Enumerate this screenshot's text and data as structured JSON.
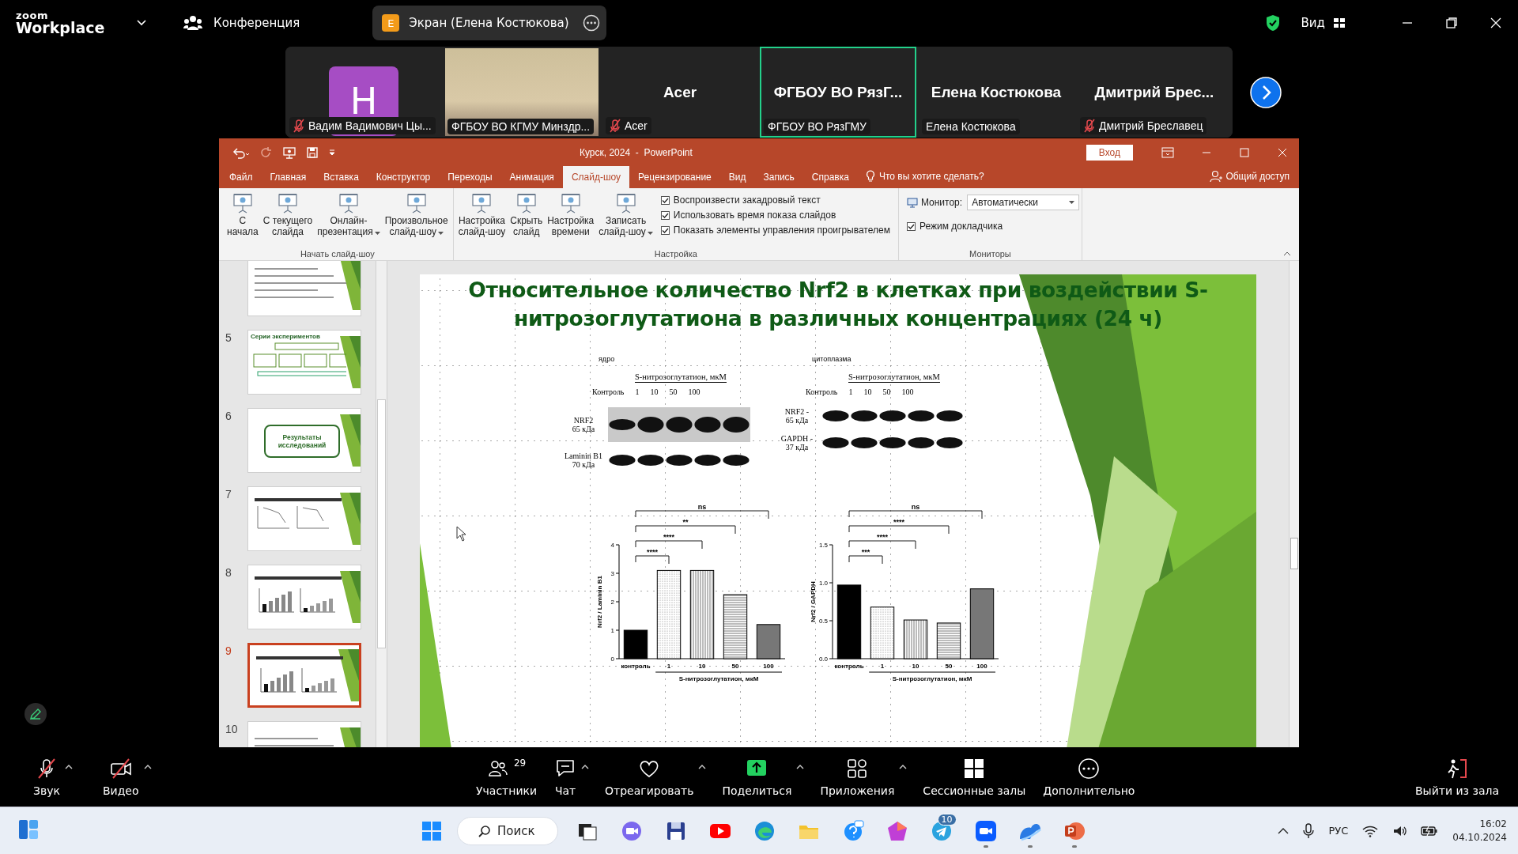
{
  "zoom_bar": {
    "logo_top": "zoom",
    "logo_bottom": "Workplace",
    "meeting": "Конференция",
    "share_pill": {
      "badge": "E",
      "label": "Экран (Елена Костюкова)"
    },
    "view": "Вид"
  },
  "participants": [
    {
      "kind": "avatar",
      "initial": "H",
      "name": "Вадим Вадимович Цы...",
      "muted": true,
      "speaking": false
    },
    {
      "kind": "video",
      "name": "ФГБОУ ВО КГМУ Минздр...",
      "muted": false,
      "speaking": false
    },
    {
      "kind": "text",
      "display": "Acer",
      "name": "Acer",
      "muted": true,
      "speaking": false
    },
    {
      "kind": "text",
      "display": "ФГБОУ ВО РязГ...",
      "name": "ФГБОУ ВО РязГМУ",
      "muted": false,
      "speaking": true
    },
    {
      "kind": "text",
      "display": "Елена Костюкова",
      "name": "Елена Костюкова",
      "muted": false,
      "speaking": false
    },
    {
      "kind": "text",
      "display": "Дмитрий Брес...",
      "name": "Дмитрий Бреславец",
      "muted": true,
      "speaking": false
    }
  ],
  "powerpoint": {
    "title": "Курск, 2024  -  PowerPoint",
    "sign_in": "Вход",
    "tabs": [
      {
        "label": "Файл",
        "selected": false
      },
      {
        "label": "Главная",
        "selected": false
      },
      {
        "label": "Вставка",
        "selected": false
      },
      {
        "label": "Конструктор",
        "selected": false
      },
      {
        "label": "Переходы",
        "selected": false
      },
      {
        "label": "Анимация",
        "selected": false
      },
      {
        "label": "Слайд-шоу",
        "selected": true
      },
      {
        "label": "Рецензирование",
        "selected": false
      },
      {
        "label": "Вид",
        "selected": false
      },
      {
        "label": "Запись",
        "selected": false
      },
      {
        "label": "Справка",
        "selected": false
      }
    ],
    "tell_me": "Что вы хотите сделать?",
    "share": "Общий доступ",
    "groups": [
      {
        "label": "Начать слайд-шоу",
        "buttons": [
          {
            "lines": [
              "С",
              "начала"
            ],
            "dropdown": false
          },
          {
            "lines": [
              "С текущего",
              "слайда"
            ],
            "dropdown": false
          },
          {
            "lines": [
              "Онлайн-",
              "презентация"
            ],
            "dropdown": true
          },
          {
            "lines": [
              "Произвольное",
              "слайд-шоу"
            ],
            "dropdown": true
          }
        ]
      },
      {
        "label": "Настройка",
        "buttons": [
          {
            "lines": [
              "Настройка",
              "слайд-шоу"
            ],
            "dropdown": false
          },
          {
            "lines": [
              "Скрыть",
              "слайд"
            ],
            "dropdown": false
          },
          {
            "lines": [
              "Настройка",
              "времени"
            ],
            "dropdown": false
          },
          {
            "lines": [
              "Записать",
              "слайд-шоу"
            ],
            "dropdown": true
          }
        ],
        "checkboxes": [
          {
            "label": "Воспроизвести закадровый текст",
            "checked": true
          },
          {
            "label": "Использовать время показа слайдов",
            "checked": true
          },
          {
            "label": "Показать элементы управления проигрывателем",
            "checked": true
          }
        ]
      },
      {
        "label": "Мониторы",
        "monitor": {
          "label": "Монитор:",
          "value": "Автоматически"
        },
        "checkboxes": [
          {
            "label": "Режим докладчика",
            "checked": true
          }
        ]
      }
    ],
    "thumbnails": [
      {
        "kind": "bullets",
        "selected": false
      },
      {
        "number": "5",
        "kind": "diagram",
        "title": "Серии экспериментов",
        "selected": false
      },
      {
        "number": "6",
        "kind": "section",
        "title": "Результаты исследований",
        "selected": false
      },
      {
        "number": "7",
        "kind": "lines",
        "selected": false
      },
      {
        "number": "8",
        "kind": "bars",
        "selected": false
      },
      {
        "number": "9",
        "kind": "bars",
        "selected": true
      },
      {
        "number": "10",
        "kind": "bullets",
        "selected": false
      }
    ],
    "slide": {
      "title": "Относительное количество Nrf2 в клетках при воздействии S-нитрозоглутатиона в различных концентрациях (24 ч)",
      "blots": [
        {
          "compartment": "ядро",
          "treatment": "S-нитрозоглутатион, мкМ",
          "lanes": [
            "Контроль",
            "1",
            "10",
            "50",
            "100"
          ],
          "rows": [
            {
              "protein": "NRF2",
              "mass": "65 кДа"
            },
            {
              "protein": "Laminin B1",
              "mass": "70 кДа"
            }
          ]
        },
        {
          "compartment": "цитоплазма",
          "treatment": "S-нитрозоглутатион, мкМ",
          "lanes": [
            "Контроль",
            "1",
            "10",
            "50",
            "100"
          ],
          "rows": [
            {
              "protein": "NRF2 -",
              "mass": "65 кДа"
            },
            {
              "protein": "GAPDH -",
              "mass": "37 кДа"
            }
          ]
        }
      ],
      "charts": [
        {
          "chart_data": {
            "type": "bar",
            "xlabel": "S-нитрозоглутатион, мкМ",
            "ylabel": "Nrf2 / Laminin B1",
            "categories": [
              "контроль",
              "1",
              "10",
              "50",
              "100"
            ],
            "values": [
              1.0,
              3.1,
              3.1,
              2.25,
              1.2
            ],
            "ylim": [
              0,
              4
            ],
            "yticks": [
              0,
              1,
              2,
              3,
              4
            ],
            "annotations": [
              {
                "text": "****"
              },
              {
                "text": "****"
              },
              {
                "text": "**"
              },
              {
                "text": "ns"
              }
            ]
          }
        },
        {
          "chart_data": {
            "type": "bar",
            "xlabel": "S-нитрозоглутатион, мкМ",
            "ylabel": "Nrf2 / GAPDH",
            "categories": [
              "контроль",
              "1",
              "10",
              "50",
              "100"
            ],
            "values": [
              0.97,
              0.68,
              0.51,
              0.47,
              0.92
            ],
            "ylim": [
              0,
              1.5
            ],
            "yticks": [
              {
                "value": 0,
                "label": "0.0"
              },
              {
                "value": 0.5,
                "label": "0.5"
              },
              {
                "value": 1,
                "label": "1.0"
              },
              {
                "value": 1.5,
                "label": "1.5"
              }
            ],
            "annotations": [
              {
                "text": "***"
              },
              {
                "text": "****"
              },
              {
                "text": "****"
              },
              {
                "text": "ns"
              }
            ]
          }
        }
      ]
    }
  },
  "toolbar": [
    {
      "kind": "audio",
      "label": "Звук",
      "off": true,
      "caret": true
    },
    {
      "kind": "video",
      "label": "Видео",
      "off": true,
      "caret": true
    },
    {
      "kind": "participants",
      "label": "Участники",
      "count": "29",
      "off": false,
      "caret": false
    },
    {
      "kind": "chat",
      "label": "Чат",
      "off": false,
      "caret": true
    },
    {
      "kind": "react",
      "label": "Отреагировать",
      "off": false,
      "caret": true
    },
    {
      "kind": "share",
      "label": "Поделиться",
      "off": false,
      "caret": true
    },
    {
      "kind": "apps",
      "label": "Приложения",
      "off": false,
      "caret": true
    },
    {
      "kind": "rooms",
      "label": "Сессионные залы",
      "off": false,
      "caret": false
    },
    {
      "kind": "more",
      "label": "Дополнительно",
      "off": false,
      "caret": false
    }
  ],
  "leave": "Выйти из зала",
  "taskbar": {
    "search": "Поиск",
    "apps": [
      {
        "kind": "taskview",
        "running": false
      },
      {
        "kind": "meet",
        "running": false
      },
      {
        "kind": "floppy",
        "running": false
      },
      {
        "kind": "youtube",
        "running": false
      },
      {
        "kind": "edge",
        "running": false
      },
      {
        "kind": "folder",
        "running": false
      },
      {
        "kind": "help",
        "running": false
      },
      {
        "kind": "gem",
        "running": false
      },
      {
        "kind": "telegram",
        "badge": "10",
        "running": false
      },
      {
        "kind": "zoom",
        "running": true
      },
      {
        "kind": "cloud",
        "running": true
      },
      {
        "kind": "powerpoint",
        "running": true
      }
    ],
    "language": "РУС",
    "time": "16:02",
    "date": "04.10.2024"
  }
}
